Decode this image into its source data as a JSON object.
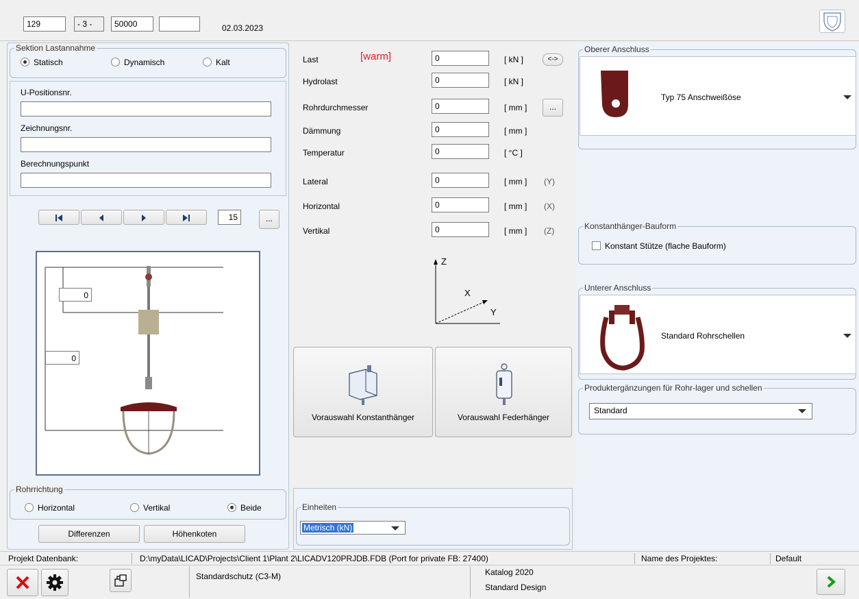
{
  "header": {
    "field1": "129",
    "field2": "- 3 -",
    "field3": "50000",
    "field4": "",
    "date": "02.03.2023"
  },
  "sektion": {
    "legend": "Sektion Lastannahme",
    "options": [
      "Statisch",
      "Dynamisch",
      "Kalt"
    ],
    "selected": "Statisch"
  },
  "fields": {
    "upos_label": "U-Positionsnr.",
    "upos_value": "",
    "zeich_label": "Zeichnungsnr.",
    "zeich_value": "",
    "berech_label": "Berechnungspunkt",
    "berech_value": ""
  },
  "nav": {
    "page": "15",
    "more": "..."
  },
  "drawing": {
    "dim1": "0",
    "dim2": "0"
  },
  "rohrrichtung": {
    "legend": "Rohrrichtung",
    "options": [
      "Horizontal",
      "Vertikal",
      "Beide"
    ],
    "selected": "Beide"
  },
  "buttons": {
    "differenzen": "Differenzen",
    "hoehenkoten": "Höhenkoten",
    "konstant": "Vorauswahl Konstanthänger",
    "feder": "Vorauswahl Federhänger"
  },
  "loads": {
    "warm_tag": "[warm]",
    "swap_btn": "<->",
    "dots_btn": "...",
    "rows": [
      {
        "label": "Last",
        "value": "0",
        "unit": "[ kN ]",
        "axis": ""
      },
      {
        "label": "Hydrolast",
        "value": "0",
        "unit": "[ kN ]",
        "axis": ""
      },
      {
        "label": "Rohrdurchmesser",
        "value": "0",
        "unit": "[ mm ]",
        "axis": ""
      },
      {
        "label": "Dämmung",
        "value": "0",
        "unit": "[ mm ]",
        "axis": ""
      },
      {
        "label": "Temperatur",
        "value": "0",
        "unit": "[ °C ]",
        "axis": ""
      },
      {
        "label": "Lateral",
        "value": "0",
        "unit": "[ mm ]",
        "axis": "(Y)"
      },
      {
        "label": "Horizontal",
        "value": "0",
        "unit": "[ mm ]",
        "axis": "(X)"
      },
      {
        "label": "Vertikal",
        "value": "0",
        "unit": "[ mm ]",
        "axis": "(Z)"
      }
    ]
  },
  "axes": {
    "z": "Z",
    "x": "X",
    "y": "Y"
  },
  "einheiten": {
    "legend": "Einheiten",
    "value": "Metrisch (kN)"
  },
  "oberer": {
    "legend": "Oberer Anschluss",
    "value": "Typ 75 Anschweißöse"
  },
  "konstant_bauform": {
    "legend": "Konstanthänger-Bauform",
    "checkbox": "Konstant Stütze (flache Bauform)"
  },
  "unterer": {
    "legend": "Unterer Anschluss",
    "value": "Standard Rohrschellen"
  },
  "produkt": {
    "legend": "Produktergänzungen für Rohr-lager und schellen",
    "value": "Standard"
  },
  "statusbar": {
    "db_label": "Projekt Datenbank:",
    "db_path": "D:\\myData\\LICAD\\Projects\\Client 1\\Plant 2\\LICADV120PRJDB.FDB (Port for private FB: 27400)",
    "name_label": "Name des Projektes:",
    "name_value": "Default"
  },
  "footer": {
    "schutz": "Standardschutz (C3-M)",
    "katalog": "Katalog 2020",
    "design": "Standard Design"
  },
  "colors": {
    "warm": "#e02020",
    "hanger": "#6b1a1a",
    "next": "#1a9a1a",
    "close": "#d01010"
  }
}
